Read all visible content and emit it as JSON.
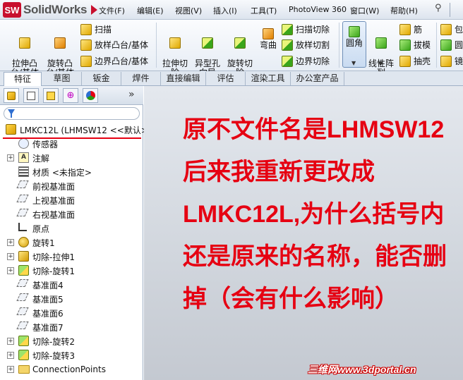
{
  "app": {
    "logo_badge": "SW",
    "logo_text": "SolidWorks"
  },
  "menu": {
    "items": [
      "文件(F)",
      "编辑(E)",
      "视图(V)",
      "插入(I)",
      "工具(T)",
      "PhotoView 360",
      "窗口(W)",
      "帮助(H)"
    ]
  },
  "ribbon": {
    "extrude_boss": "拉伸凸\n台/基体",
    "revolve_boss": "旋转凸\n台/基体",
    "sweep": "扫描",
    "loft": "放样凸台/基体",
    "boundary_boss": "边界凸台/基体",
    "extrude_cut": "拉伸切\n除",
    "hole_wizard": "异型孔\n向导",
    "revolve_cut": "旋转切\n除",
    "bend": "弯曲",
    "swept_cut": "扫描切除",
    "lofted_cut": "放样切割",
    "boundary_cut": "边界切除",
    "fillet": "圆角",
    "linear_pattern": "线性阵\n列",
    "rib": "筋",
    "draft": "拔模",
    "shell": "抽壳",
    "wrap": "包",
    "dome": "圆",
    "mirror": "镜"
  },
  "cm_tabs": [
    "特征",
    "草图",
    "钣金",
    "焊件",
    "直接编辑",
    "评估",
    "渲染工具",
    "办公室产品"
  ],
  "tree": {
    "root": "LMKC12L  (LHMSW12 <<默认>",
    "items": [
      {
        "label": "传感器",
        "icon": "sensor-icon",
        "expandable": false
      },
      {
        "label": "注解",
        "icon": "annotation-icon",
        "expandable": true
      },
      {
        "label": "材质 <未指定>",
        "icon": "material-icon",
        "expandable": false
      },
      {
        "label": "前视基准面",
        "icon": "plane-icon",
        "expandable": false
      },
      {
        "label": "上视基准面",
        "icon": "plane-icon",
        "expandable": false
      },
      {
        "label": "右视基准面",
        "icon": "plane-icon",
        "expandable": false
      },
      {
        "label": "原点",
        "icon": "origin-icon",
        "expandable": false
      },
      {
        "label": "旋转1",
        "icon": "revolve-icon",
        "expandable": true
      },
      {
        "label": "切除-拉伸1",
        "icon": "cut-extrude-icon",
        "expandable": true
      },
      {
        "label": "切除-旋转1",
        "icon": "cut-revolve-icon",
        "expandable": true
      },
      {
        "label": "基准面4",
        "icon": "plane-icon",
        "expandable": false
      },
      {
        "label": "基准面5",
        "icon": "plane-icon",
        "expandable": false
      },
      {
        "label": "基准面6",
        "icon": "plane-icon",
        "expandable": false
      },
      {
        "label": "基准面7",
        "icon": "plane-icon",
        "expandable": false
      },
      {
        "label": "切除-旋转2",
        "icon": "cut-revolve-icon",
        "expandable": true
      },
      {
        "label": "切除-旋转3",
        "icon": "cut-revolve-icon",
        "expandable": true
      },
      {
        "label": "ConnectionPoints",
        "icon": "folder-icon",
        "expandable": true
      }
    ]
  },
  "message": {
    "lines": [
      "原不文件名是LHMSW12",
      "后来我重新更改成",
      "LMKC12L,为什么括号内",
      "还是原来的名称，能否删",
      "掉（会有什么影响）"
    ]
  },
  "watermark": "三维网www.3dportal.cn",
  "colors": {
    "message": "#e60012",
    "underline": "#e60012",
    "brand": "#c8102e"
  }
}
